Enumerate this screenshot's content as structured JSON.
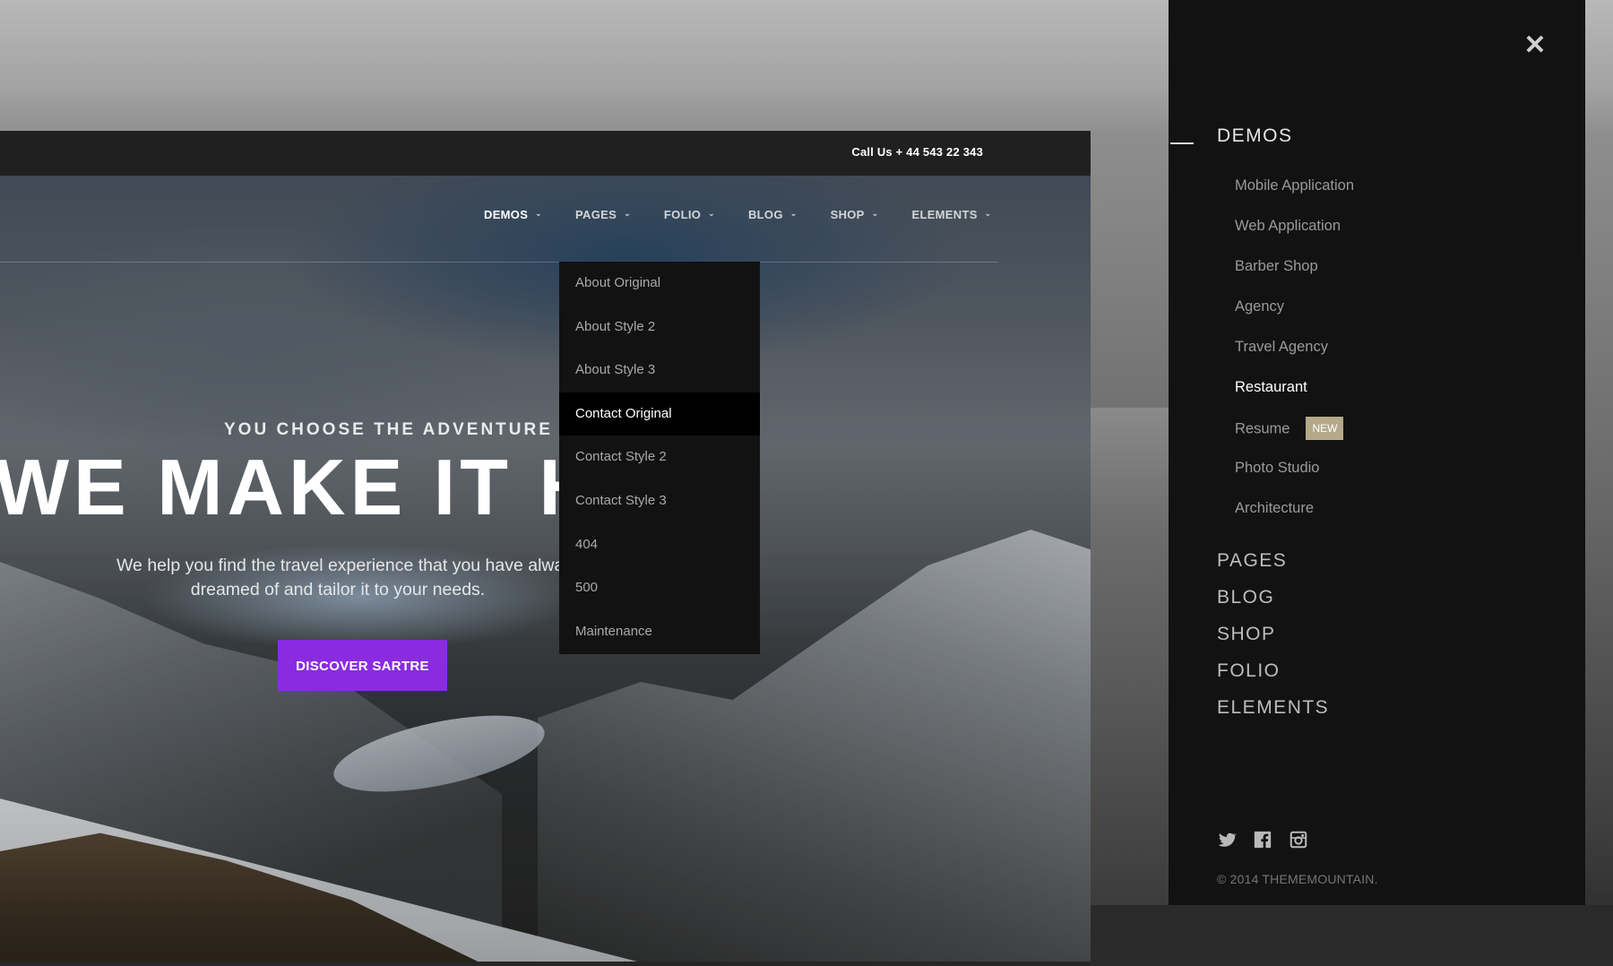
{
  "topbar": {
    "call_us": "Call Us + 44 543 22 343"
  },
  "nav": {
    "items": [
      {
        "label": "DEMOS",
        "active": true
      },
      {
        "label": "PAGES",
        "active": false
      },
      {
        "label": "FOLIO",
        "active": false
      },
      {
        "label": "BLOG",
        "active": false
      },
      {
        "label": "SHOP",
        "active": false
      },
      {
        "label": "ELEMENTS",
        "active": false
      }
    ]
  },
  "dropdown": {
    "items": [
      {
        "label": "About Original"
      },
      {
        "label": "About Style 2"
      },
      {
        "label": "About Style 3"
      },
      {
        "label": "Contact Original",
        "active": true
      },
      {
        "label": "Contact Style 2"
      },
      {
        "label": "Contact Style 3"
      },
      {
        "label": "404"
      },
      {
        "label": "500"
      },
      {
        "label": "Maintenance"
      }
    ]
  },
  "hero": {
    "eyebrow": "YOU CHOOSE THE ADVENTURE",
    "headline": "WE MAKE IT HAPPEN",
    "sub_line1": "We help you find the travel experience that you have always",
    "sub_line2": "dreamed of and tailor it to your needs.",
    "cta": "DISCOVER SARTRE"
  },
  "panel": {
    "close_icon": "close-icon",
    "demos_title": "DEMOS",
    "demos_items": [
      {
        "label": "Mobile Application"
      },
      {
        "label": "Web Application"
      },
      {
        "label": "Barber Shop"
      },
      {
        "label": "Agency"
      },
      {
        "label": "Travel Agency"
      },
      {
        "label": "Restaurant",
        "active": true
      },
      {
        "label": "Resume",
        "badge": "NEW"
      },
      {
        "label": "Photo Studio"
      },
      {
        "label": "Architecture"
      }
    ],
    "sections": [
      {
        "label": "PAGES"
      },
      {
        "label": "BLOG"
      },
      {
        "label": "SHOP"
      },
      {
        "label": "FOLIO"
      },
      {
        "label": "ELEMENTS"
      }
    ],
    "social": [
      "twitter-icon",
      "facebook-icon",
      "instagram-icon"
    ],
    "copyright": "© 2014 THEMEMOUNTAIN."
  },
  "colors": {
    "accent": "#8a2be2",
    "panel_bg": "#121212",
    "badge_bg": "#b5a98a"
  }
}
